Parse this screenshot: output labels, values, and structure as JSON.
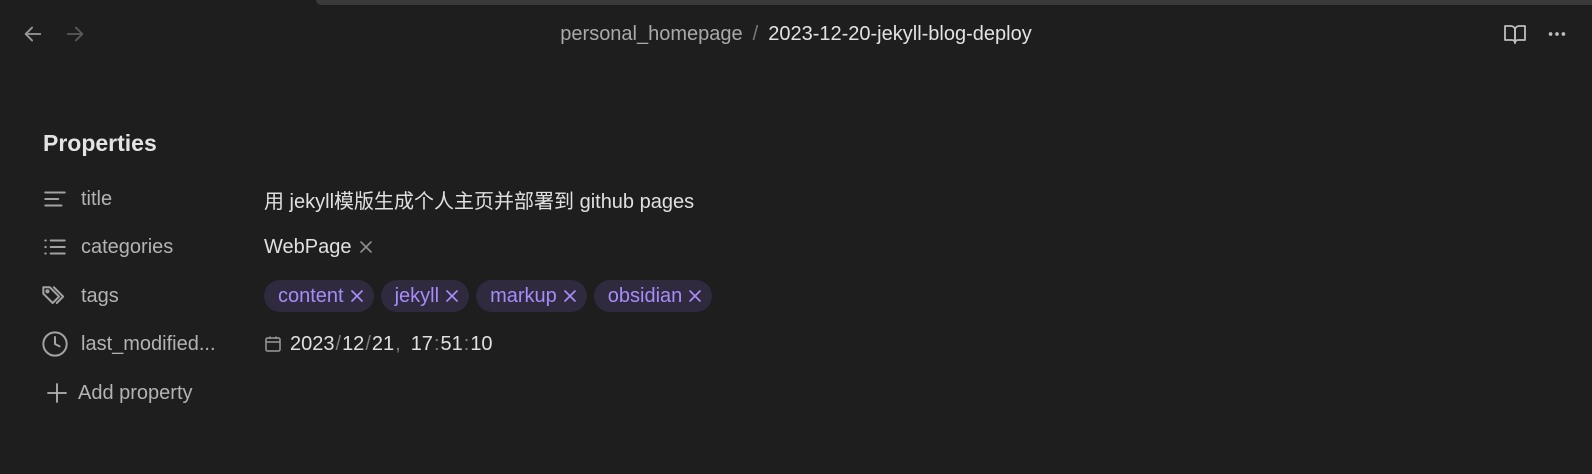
{
  "header": {
    "breadcrumb_parent": "personal_homepage",
    "breadcrumb_separator": "/",
    "breadcrumb_current": "2023-12-20-jekyll-blog-deploy"
  },
  "icons": {
    "back": "arrow-left-icon",
    "forward": "arrow-right-icon",
    "reading_view": "book-open-icon",
    "more": "more-horizontal-icon",
    "text": "align-left-icon",
    "list": "list-icon",
    "tags": "tags-icon",
    "datetime": "clock-icon",
    "calendar": "calendar-icon",
    "remove": "x-icon",
    "add": "plus-icon"
  },
  "colors": {
    "background": "#1e1e1e",
    "tag_background": "#2f2a3d",
    "tag_text": "#a88bfa"
  },
  "properties": {
    "heading": "Properties",
    "title": {
      "key": "title",
      "value": "用 jekyll模版生成个人主页并部署到 github pages"
    },
    "categories": {
      "key": "categories",
      "values": [
        "WebPage"
      ]
    },
    "tags": {
      "key": "tags",
      "values": [
        "content",
        "jekyll",
        "markup",
        "obsidian"
      ]
    },
    "last_modified": {
      "key": "last_modified...",
      "year": "2023",
      "month": "12",
      "day": "21",
      "date_sep": "/",
      "datetime_sep": ",",
      "hour": "17",
      "minute": "51",
      "second": "10",
      "time_sep": ":"
    },
    "add_label": "Add property"
  }
}
